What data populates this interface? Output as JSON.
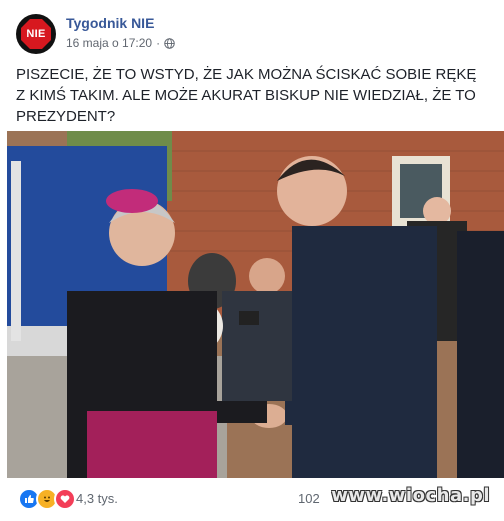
{
  "page": {
    "name": "Tygodnik NIE",
    "avatar_text": "NIE",
    "avatar_color": "#d7181f",
    "date": "16 maja o 17:20",
    "privacy_icon": "globe-icon"
  },
  "post": {
    "text": "PISZECIE, ŻE TO WSTYD, ŻE JAK MOŻNA ŚCISKAĆ SOBIE RĘKĘ Z KIMŚ TAKIM. ALE MOŻE AKURAT BISKUP NIE WIEDZIAŁ, ŻE TO PREZYDENT?",
    "photo_icon": "photo-handshake"
  },
  "footer": {
    "reactions": [
      "like-icon",
      "haha-icon",
      "love-icon"
    ],
    "reaction_count": "4,3 tys.",
    "comments_partial": "102",
    "watermark": "www.wiocha.pl"
  },
  "colors": {
    "link_blue": "#385898",
    "like_blue": "#1877f2",
    "haha_yellow": "#f7b125",
    "love_red": "#f33e58"
  }
}
